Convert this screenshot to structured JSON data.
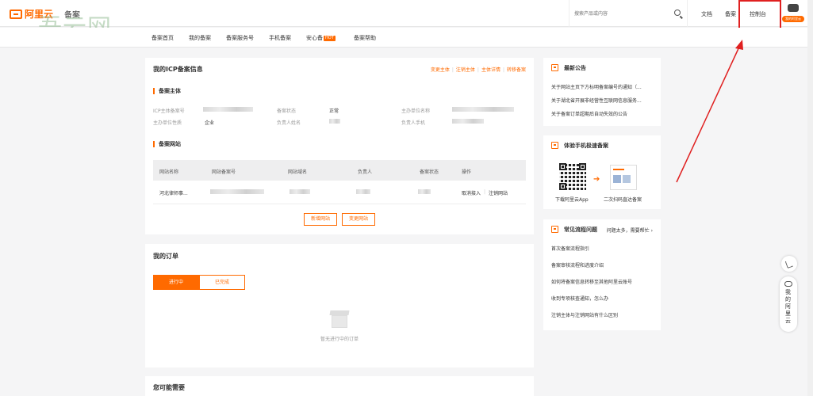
{
  "header": {
    "logo_text": "阿里云",
    "logo_sub": "备案",
    "watermark": "吾云网",
    "search_placeholder": "搜索产品或内容",
    "links": {
      "docs": "文档",
      "beian": "备案",
      "console": "控制台"
    },
    "avatar_badge": "我的阿里云"
  },
  "subnav": {
    "items": [
      "备案首页",
      "我的备案",
      "备案服务号",
      "手机备案",
      "安心备",
      "备案帮助"
    ],
    "hot_badge": "HOT"
  },
  "icp": {
    "title": "我的ICP备案信息",
    "actions": [
      "变更主体",
      "注销主体",
      "主体详情",
      "转移备案"
    ],
    "subject_section": "备案主体",
    "fields": {
      "record_no_label": "ICP主体备案号",
      "status_label": "备案状态",
      "status_value": "正常",
      "org_name_label": "主办单位名称",
      "org_type_label": "主办单位性质",
      "org_type_value": "企业",
      "owner_label": "负责人姓名",
      "phone_label": "负责人手机"
    },
    "website_section": "备案网站",
    "table_headers": [
      "网站名称",
      "网站备案号",
      "网站域名",
      "负责人",
      "备案状态",
      "操作"
    ],
    "rows": [
      {
        "name": "河北律师事...",
        "ops": [
          "取消接入",
          "注销网站"
        ]
      }
    ],
    "btn_new_site": "新增网站",
    "btn_change_site": "变更网站"
  },
  "orders": {
    "title": "我的订单",
    "tab_active": "进行中",
    "tab_done": "已完成",
    "empty_text": "暂无进行中的订单"
  },
  "maybe_need": {
    "title": "您可能需要"
  },
  "announcements": {
    "title": "最新公告",
    "items": [
      "关于网站主页下方标明备案编号的通知（...",
      "关于湖北省开展非经营性互联网信息服务...",
      "关于备案订单超期后自动失效的公告"
    ]
  },
  "mobile": {
    "title": "体验手机极速备案",
    "cap_download": "下载阿里云App",
    "cap_scan": "二次扫码直达备案"
  },
  "faq": {
    "title": "常见流程问题",
    "more": "问题太多，需要帮忙",
    "items": [
      "首次备案流程指引",
      "备案审核流程和进度介绍",
      "如何将备案信息转移至其他阿里云账号",
      "收到专项核查通知，怎么办",
      "注销主体与注销网站有什么区别"
    ]
  },
  "float": {
    "pill_text": "我的阿里云"
  },
  "colors": {
    "accent": "#ff6a00",
    "annotation": "#e02020"
  }
}
